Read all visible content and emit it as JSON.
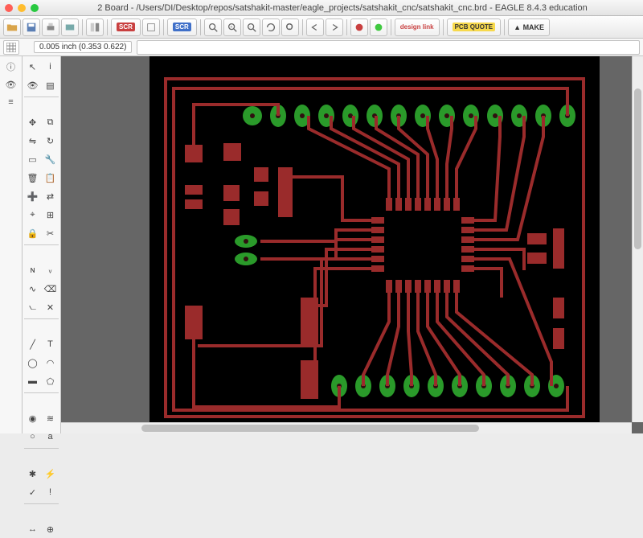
{
  "window": {
    "title": "2 Board - /Users/DI/Desktop/repos/satshakit-master/eagle_projects/satshakit_cnc/satshakit_cnc.brd - EAGLE 8.4.3 education"
  },
  "toolbar": {
    "scr": "SCR",
    "design_link": "design link",
    "pcb_quote": "PCB QUOTE",
    "make": "MAKE"
  },
  "coordbar": {
    "coords": "0.005 inch (0.353 0.622)",
    "command": ""
  },
  "leftpanel": {
    "items": [
      "info",
      "eye",
      "layers"
    ]
  },
  "palette": {
    "sections": [
      [
        "cursor-icon",
        "info-icon"
      ],
      [
        "eye-icon",
        "layers-icon"
      ],
      [
        "move-icon",
        "copy-icon"
      ],
      [
        "mirror-icon",
        "rotate-icon"
      ],
      [
        "group-icon",
        "change-icon"
      ],
      [
        "trash-icon",
        "wrench-icon"
      ],
      [
        "add-icon",
        "replace-icon"
      ],
      [
        "grid-small-icon",
        "grid-large-icon"
      ],
      [
        "lock-icon",
        "unlock-icon"
      ],
      [
        "name-icon",
        "value-icon"
      ],
      [
        "route-icon",
        "ripup-icon"
      ],
      [
        "miter-icon",
        "split-icon"
      ],
      [
        "wire-icon",
        "text-icon"
      ],
      [
        "circle-icon",
        "arc-icon"
      ],
      [
        "rect-icon",
        "polygon-icon"
      ],
      [
        "dbstack-icon",
        "db-icon"
      ],
      [
        "ratsnest-icon",
        "drc-icon"
      ],
      [
        "dim-icon",
        "mark-icon"
      ]
    ]
  },
  "colors": {
    "pcb_bg": "#000000",
    "copper": "#9a2b2b",
    "pad": "#2a9a2a",
    "drill": "#301010"
  }
}
